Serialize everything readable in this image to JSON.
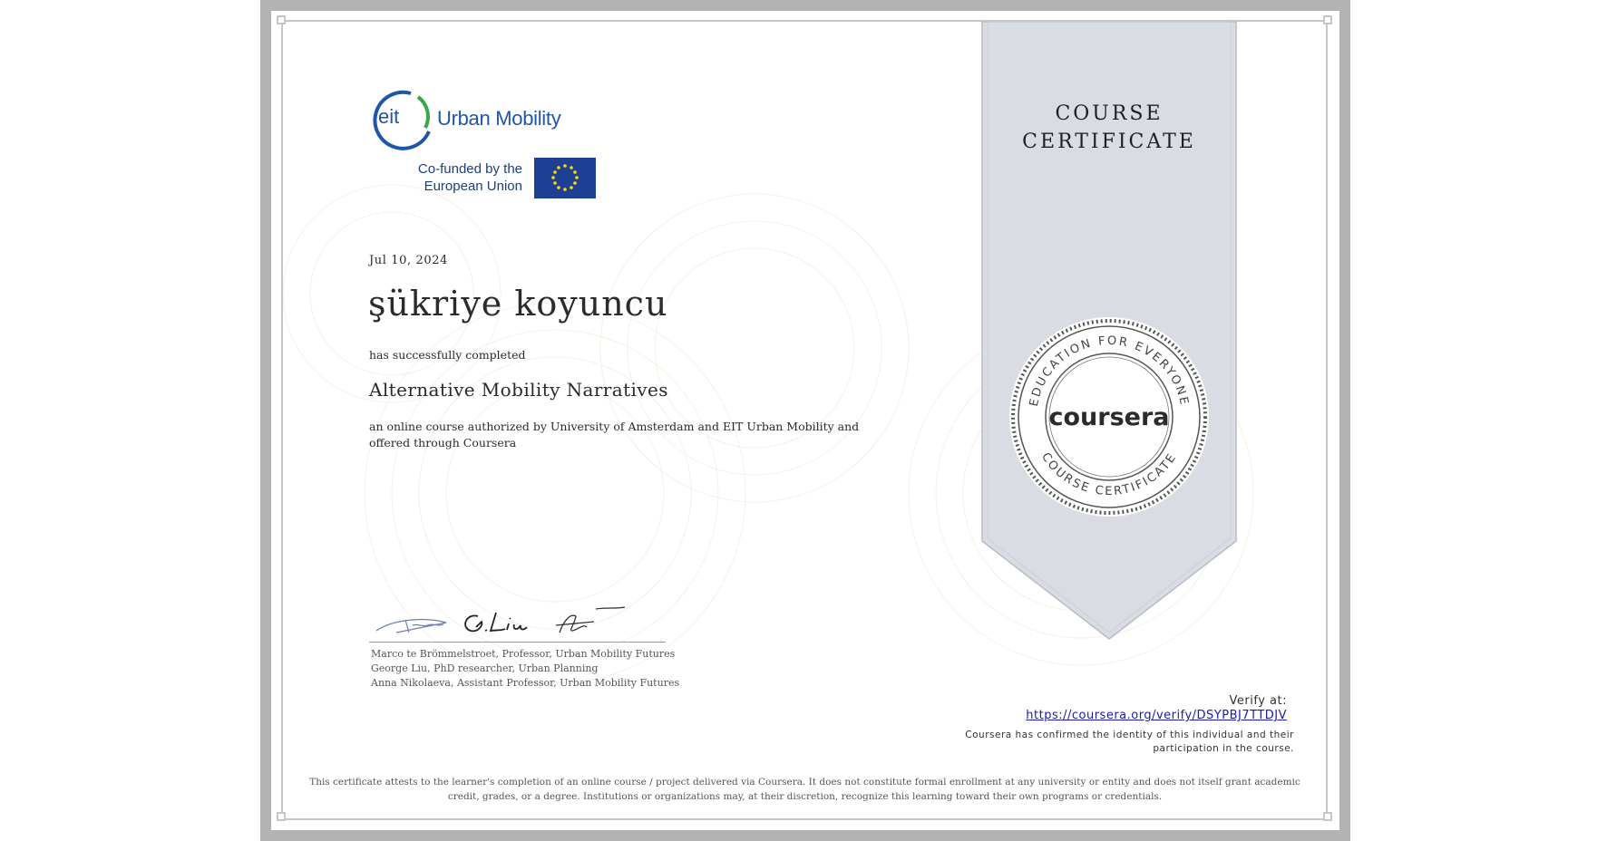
{
  "ribbon": {
    "title_line1": "COURSE",
    "title_line2": "CERTIFICATE"
  },
  "seal": {
    "top_text": "EDUCATION FOR EVERYONE",
    "bottom_text": "COURSE CERTIFICATE",
    "brand": "coursera"
  },
  "logo": {
    "eit_badge": "eit",
    "eit_name": "Urban Mobility",
    "cofunded_line1": "Co-funded by the",
    "cofunded_line2": "European Union"
  },
  "certificate": {
    "date": "Jul 10, 2024",
    "recipient": "şükriye koyuncu",
    "completed_text": "has successfully completed",
    "course_name": "Alternative Mobility Narratives",
    "authorized_text": "an online course authorized by University of Amsterdam and EIT Urban Mobility and offered through Coursera"
  },
  "signers": [
    "Marco te Brömmelstroet, Professor, Urban Mobility Futures",
    "George Liu, PhD researcher, Urban Planning",
    "Anna Nikolaeva, Assistant Professor, Urban Mobility Futures"
  ],
  "verify": {
    "label": "Verify at:",
    "url": "https://coursera.org/verify/DSYPBJ7TTDJV",
    "identity_text": "Coursera has confirmed the identity of this individual and their participation in the course."
  },
  "disclaimer": "This certificate attests to the learner's completion of an online course / project delivered via Coursera. It does not constitute formal enrollment at any university or entity and does not itself grant academic credit, grades, or a degree. Institutions or organizations may, at their discretion, recognize this learning toward their own programs or credentials.",
  "colors": {
    "frame": "#b3b3b3",
    "ribbon": "#d9dde3",
    "eit_blue": "#2056a6",
    "eit_green": "#3aa54a",
    "eu_blue": "#1d3f94",
    "eu_gold": "#ffdd00",
    "link": "#1a1ab0"
  }
}
